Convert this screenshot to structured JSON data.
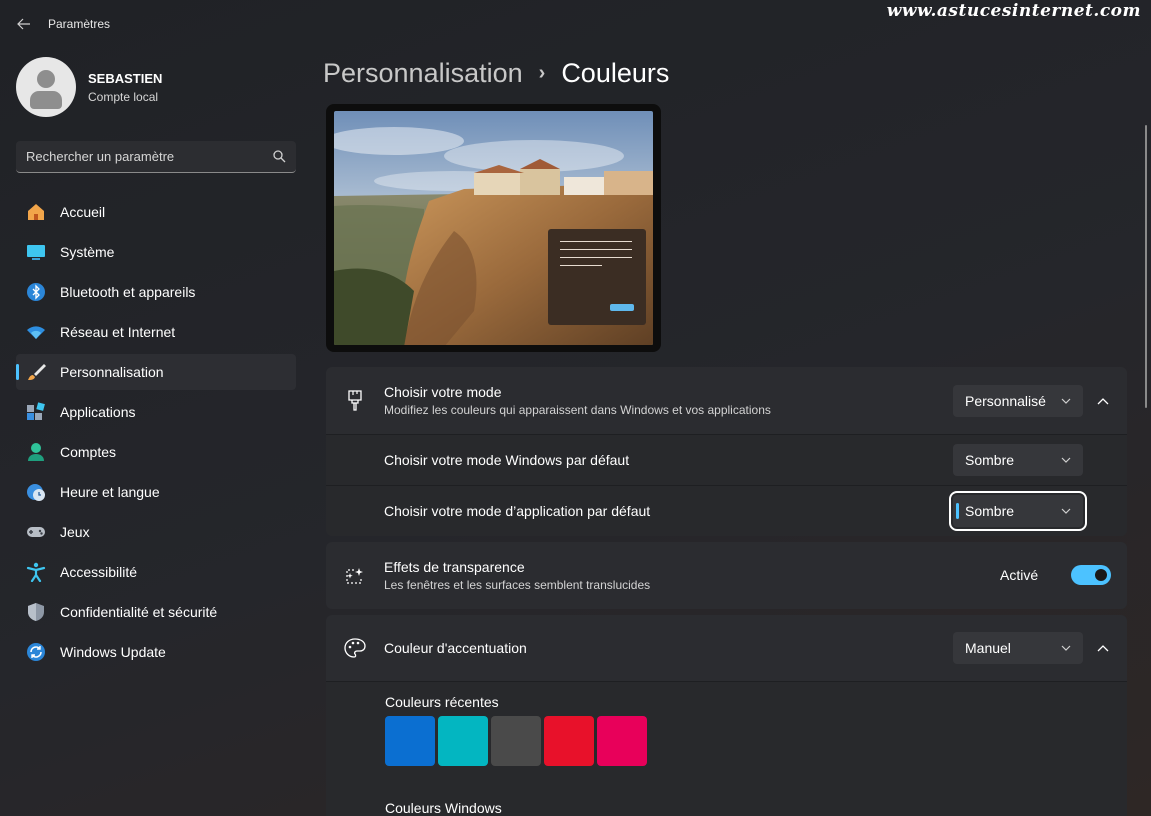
{
  "watermark": "www.astucesinternet.com",
  "app": {
    "title": "Paramètres",
    "back_icon": "arrow-left-icon"
  },
  "profile": {
    "name": "SEBASTIEN",
    "account": "Compte local"
  },
  "search": {
    "placeholder": "Rechercher un paramètre",
    "icon": "search-icon"
  },
  "nav": {
    "items": [
      {
        "label": "Accueil",
        "icon": "home-icon",
        "active": false
      },
      {
        "label": "Système",
        "icon": "monitor-icon",
        "active": false
      },
      {
        "label": "Bluetooth et appareils",
        "icon": "bluetooth-icon",
        "active": false
      },
      {
        "label": "Réseau et Internet",
        "icon": "wifi-icon",
        "active": false
      },
      {
        "label": "Personnalisation",
        "icon": "brush-icon",
        "active": true
      },
      {
        "label": "Applications",
        "icon": "apps-icon",
        "active": false
      },
      {
        "label": "Comptes",
        "icon": "person-icon",
        "active": false
      },
      {
        "label": "Heure et langue",
        "icon": "clock-globe-icon",
        "active": false
      },
      {
        "label": "Jeux",
        "icon": "gamepad-icon",
        "active": false
      },
      {
        "label": "Accessibilité",
        "icon": "accessibility-icon",
        "active": false
      },
      {
        "label": "Confidentialité et sécurité",
        "icon": "shield-icon",
        "active": false
      },
      {
        "label": "Windows Update",
        "icon": "sync-icon",
        "active": false
      }
    ]
  },
  "breadcrumb": {
    "parent": "Personnalisation",
    "separator": "›",
    "current": "Couleurs"
  },
  "mode": {
    "title": "Choisir votre mode",
    "description": "Modifiez les couleurs qui apparaissent dans Windows et vos applications",
    "value": "Personnalisé",
    "windows_label": "Choisir votre mode Windows par défaut",
    "windows_value": "Sombre",
    "app_label": "Choisir votre mode d’application par défaut",
    "app_value": "Sombre"
  },
  "transparency": {
    "title": "Effets de transparence",
    "description": "Les fenêtres et les surfaces semblent translucides",
    "state_label": "Activé",
    "on": true
  },
  "accent": {
    "title": "Couleur d'accentuation",
    "value": "Manuel",
    "recent_label": "Couleurs récentes",
    "recent_colors": [
      "#0b6fd1",
      "#03b6c1",
      "#4a4a4a",
      "#e8112a",
      "#e8005a"
    ],
    "windows_label": "Couleurs Windows"
  },
  "colors": {
    "accent": "#4cc2ff",
    "preview_window": "#3b2d23"
  }
}
